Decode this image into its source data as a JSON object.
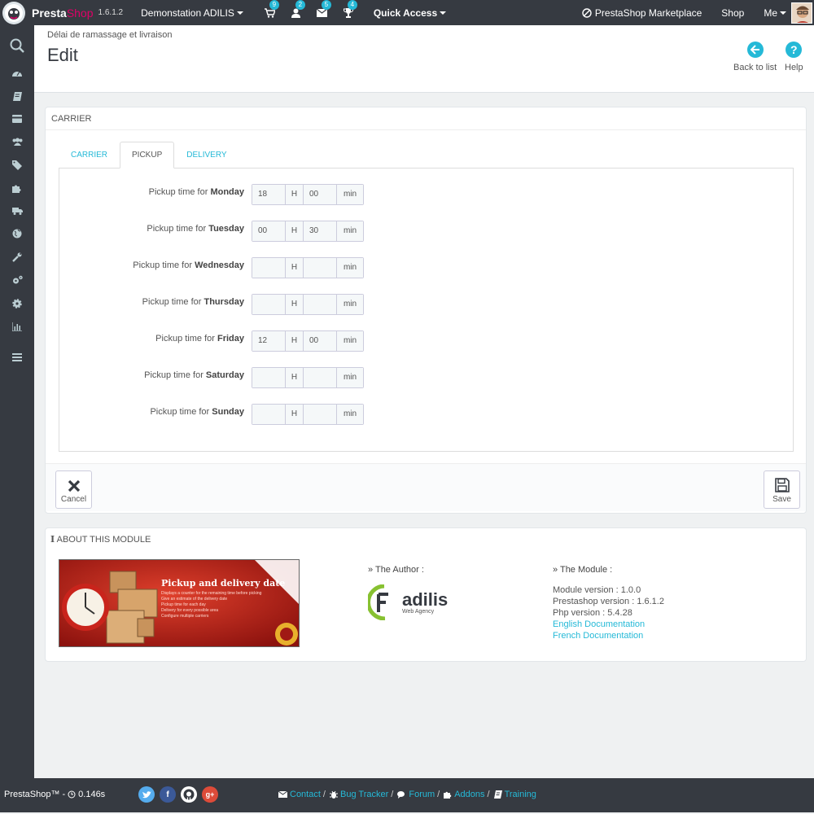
{
  "topbar": {
    "brand_presta": "Presta",
    "brand_shop": "Shop",
    "version": "1.6.1.2",
    "store_name": "Demonstation ADILIS",
    "notifications": [
      {
        "icon": "cart-icon",
        "count": "9"
      },
      {
        "icon": "user-icon",
        "count": "2"
      },
      {
        "icon": "envelope-icon",
        "count": "5"
      },
      {
        "icon": "trophy-icon",
        "count": "4"
      }
    ],
    "quick_access": "Quick Access",
    "marketplace": "PrestaShop Marketplace",
    "shop": "Shop",
    "me": "Me"
  },
  "header": {
    "breadcrumb": "Délai de ramassage et livraison",
    "title": "Edit",
    "back_label": "Back to list",
    "help_label": "Help"
  },
  "carrier_panel": {
    "heading": "CARRIER",
    "tabs": [
      {
        "label": "CARRIER",
        "active": false
      },
      {
        "label": "PICKUP",
        "active": true
      },
      {
        "label": "DELIVERY",
        "active": false
      }
    ],
    "label_prefix": "Pickup time for",
    "hour_unit": "H",
    "minute_unit": "min",
    "rows": [
      {
        "day": "Monday",
        "hour": "18",
        "minute": "00"
      },
      {
        "day": "Tuesday",
        "hour": "00",
        "minute": "30"
      },
      {
        "day": "Wednesday",
        "hour": "",
        "minute": ""
      },
      {
        "day": "Thursday",
        "hour": "",
        "minute": ""
      },
      {
        "day": "Friday",
        "hour": "12",
        "minute": "00"
      },
      {
        "day": "Saturday",
        "hour": "",
        "minute": ""
      },
      {
        "day": "Sunday",
        "hour": "",
        "minute": ""
      }
    ],
    "cancel_label": "Cancel",
    "save_label": "Save"
  },
  "about": {
    "heading": "ABOUT THIS MODULE",
    "banner_title": "Pickup and delivery date",
    "banner_lines": [
      "Displays a counter for the remaining time before picking",
      "Give an estimate of the delivery date",
      "Pickup time for each day",
      "Delivery for every possible area",
      "Configure multiple carriers"
    ],
    "author_heading": "» The Author :",
    "author_name": "adilis",
    "author_sub": "Web Agency",
    "module_heading": "» The Module :",
    "module_version": "Module version : 1.0.0",
    "prestashop_version": "Prestashop version : 1.6.1.2",
    "php_version": "Php version : 5.4.28",
    "english_doc": "English Documentation",
    "french_doc": "French Documentation"
  },
  "footer": {
    "product": "PrestaShop™",
    "timing": "0.146s",
    "links": [
      "Contact",
      "Bug Tracker",
      "Forum",
      "Addons",
      "Training"
    ]
  },
  "colors": {
    "topbar": "#363a41",
    "accent": "#25b9d7",
    "brand_pink": "#df0067"
  }
}
